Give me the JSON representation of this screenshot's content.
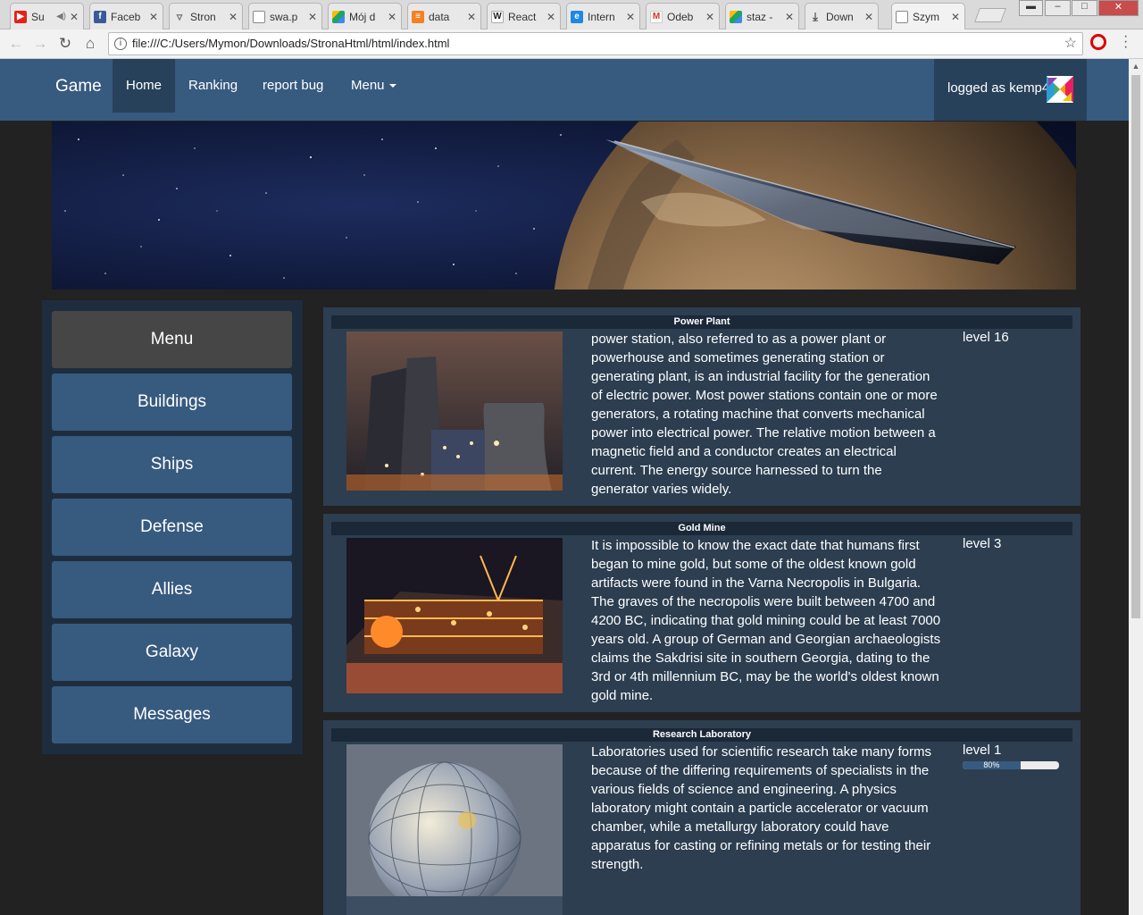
{
  "browser": {
    "tabs": [
      {
        "title": "Su",
        "icon": "youtube-icon",
        "color": "#e62117"
      },
      {
        "title": "Faceb",
        "icon": "facebook-icon",
        "color": "#3b5998"
      },
      {
        "title": "Stron",
        "icon": "page-icon",
        "color": "#888888"
      },
      {
        "title": "swa.p",
        "icon": "document-icon",
        "color": "#888888"
      },
      {
        "title": "Mój d",
        "icon": "google-drive-icon",
        "color": "#1fa463"
      },
      {
        "title": "data",
        "icon": "stackoverflow-icon",
        "color": "#f48024"
      },
      {
        "title": "React",
        "icon": "wikipedia-icon",
        "color": "#333333"
      },
      {
        "title": "Intern",
        "icon": "ie-icon",
        "color": "#1e88e5"
      },
      {
        "title": "Odeb",
        "icon": "gmail-icon",
        "color": "#d93025"
      },
      {
        "title": "staz -",
        "icon": "google-drive-icon",
        "color": "#1fa463"
      },
      {
        "title": "Down",
        "icon": "download-icon",
        "color": "#555555"
      },
      {
        "title": "Szym",
        "icon": "document-icon",
        "color": "#888888"
      }
    ],
    "url": "file:///C:/Users/Mymon/Downloads/StronaHtml/html/index.html"
  },
  "navbar": {
    "brand": "Game",
    "links": [
      "Home",
      "Ranking",
      "report bug",
      "Menu"
    ],
    "active_link": "Home",
    "user_text": "logged as kemp4"
  },
  "sidebar": {
    "title": "Menu",
    "items": [
      "Buildings",
      "Ships",
      "Defense",
      "Allies",
      "Galaxy",
      "Messages"
    ]
  },
  "buildings": [
    {
      "title": "Power Plant",
      "description": "power station, also referred to as a power plant or powerhouse and sometimes generating station or generating plant, is an industrial facility for the generation of electric power. Most power stations contain one or more generators, a rotating machine that converts mechanical power into electrical power. The relative motion between a magnetic field and a conductor creates an electrical current. The energy source harnessed to turn the generator varies widely.",
      "level": "level 16"
    },
    {
      "title": "Gold Mine",
      "description": "It is impossible to know the exact date that humans first began to mine gold, but some of the oldest known gold artifacts were found in the Varna Necropolis in Bulgaria. The graves of the necropolis were built between 4700 and 4200 BC, indicating that gold mining could be at least 7000 years old. A group of German and Georgian archaeologists claims the Sakdrisi site in southern Georgia, dating to the 3rd or 4th millennium BC, may be the world's oldest known gold mine.",
      "level": "level 3"
    },
    {
      "title": "Research Laboratory",
      "description": "Laboratories used for scientific research take many forms because of the differing requirements of specialists in the various fields of science and engineering. A physics laboratory might contain a particle accelerator or vacuum chamber, while a metallurgy laboratory could have apparatus for casting or refining metals or for testing their strength.",
      "level": "level 1",
      "progress": 80,
      "progress_label": "80%"
    }
  ],
  "colors": {
    "navbar": "#375a7f",
    "navbar_active": "#28415b",
    "page_bg": "#222222",
    "card_bg": "#2c3e50",
    "sidebar_bg": "#1e2d3e",
    "menu_head": "#464646"
  }
}
